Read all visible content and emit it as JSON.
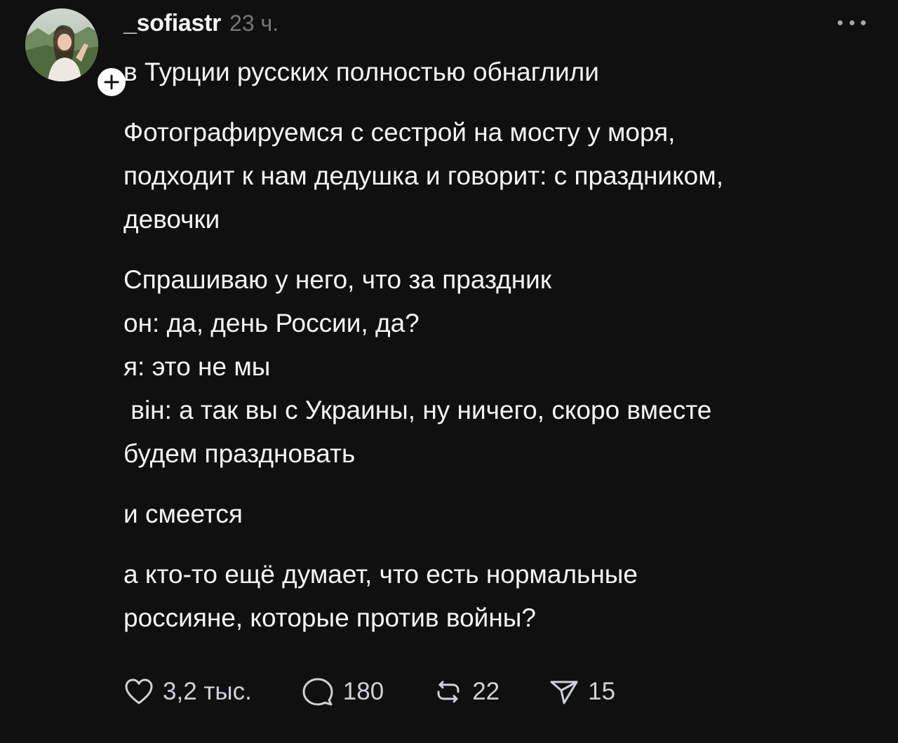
{
  "post": {
    "username": "_sofiastr",
    "timestamp": "23 ч.",
    "avatar_icon": "profile-photo",
    "follow_icon": "plus-icon",
    "more_icon": "ellipsis-icon",
    "paragraphs": [
      "в Турции русских полностью обнаглили",
      "Фотографируемся с сестрой на мосту у моря,\nподходит к нам дедушка и говорит: с праздником,\nдевочки",
      "Спрашиваю у него, что за праздник\nон: да, день России, да?\nя: это не мы\n вiн: а так вы с Украины, ну ничего, скоро вместе\nбудем праздновать",
      "и смеется",
      "а кто-то ещё думает, что есть нормальные\nроссияне, которые против войны?"
    ]
  },
  "actions": {
    "like_count": "3,2 тыс.",
    "reply_count": "180",
    "repost_count": "22",
    "share_count": "15"
  },
  "colors": {
    "background": "#101010",
    "text": "#f3f5f7",
    "muted": "#777777"
  }
}
